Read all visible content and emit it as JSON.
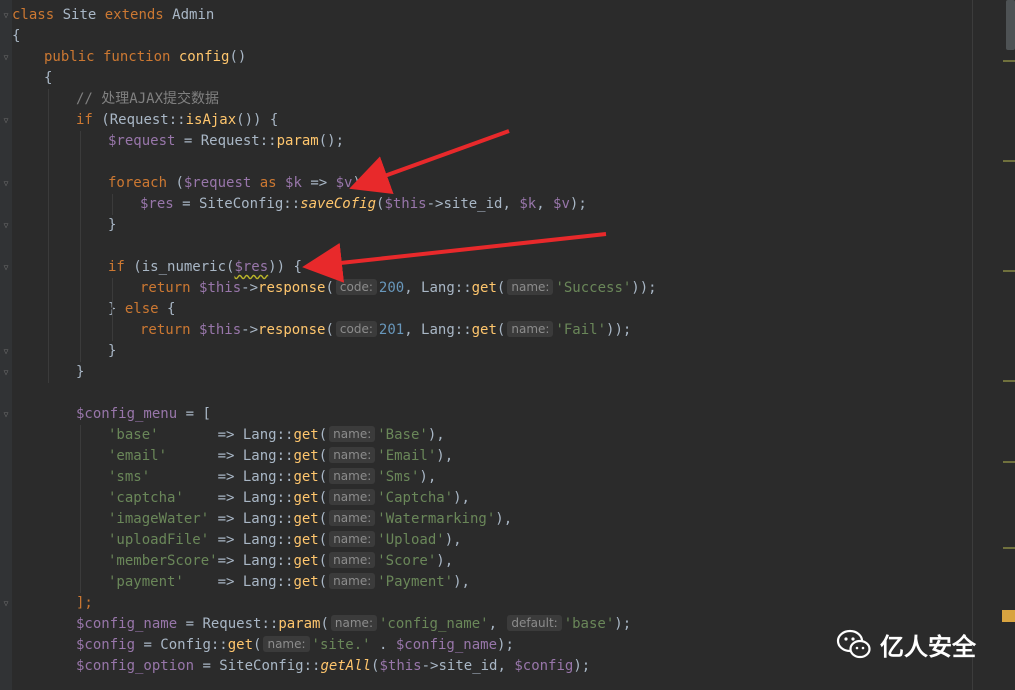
{
  "editor": {
    "language": "PHP",
    "lines": [
      {
        "i": 0,
        "tokens": [
          [
            "kw",
            "class"
          ],
          [
            "p",
            " Site "
          ],
          [
            "kw",
            "extends"
          ],
          [
            "p",
            " Admin"
          ]
        ]
      },
      {
        "i": 0,
        "tokens": [
          [
            "p",
            "{"
          ]
        ]
      },
      {
        "i": 1,
        "tokens": [
          [
            "kw",
            "public function "
          ],
          [
            "fn",
            "config"
          ],
          [
            "p",
            "()"
          ]
        ]
      },
      {
        "i": 1,
        "tokens": [
          [
            "p",
            "{"
          ]
        ]
      },
      {
        "i": 2,
        "tokens": [
          [
            "cmt",
            "// 处理AJAX提交数据"
          ]
        ]
      },
      {
        "i": 2,
        "tokens": [
          [
            "kw",
            "if "
          ],
          [
            "p",
            "(Request::"
          ],
          [
            "fn",
            "isAjax"
          ],
          [
            "p",
            "()) {"
          ]
        ]
      },
      {
        "i": 3,
        "tokens": [
          [
            "var",
            "$request"
          ],
          [
            "p",
            " = Request::"
          ],
          [
            "fn",
            "param"
          ],
          [
            "p",
            "();"
          ]
        ]
      },
      {
        "i": 3,
        "tokens": []
      },
      {
        "i": 3,
        "tokens": [
          [
            "kw",
            "foreach "
          ],
          [
            "p",
            "("
          ],
          [
            "var",
            "$request"
          ],
          [
            "kw",
            " as "
          ],
          [
            "var",
            "$k"
          ],
          [
            "p",
            " => "
          ],
          [
            "var",
            "$v"
          ],
          [
            "p",
            ") {"
          ]
        ]
      },
      {
        "i": 4,
        "tokens": [
          [
            "var",
            "$res"
          ],
          [
            "p",
            " = SiteConfig::"
          ],
          [
            "fn-i",
            "saveCofig"
          ],
          [
            "p",
            "("
          ],
          [
            "var",
            "$this"
          ],
          [
            "p",
            "->site_id, "
          ],
          [
            "var",
            "$k"
          ],
          [
            "p",
            ", "
          ],
          [
            "var",
            "$v"
          ],
          [
            "p",
            ");"
          ]
        ]
      },
      {
        "i": 3,
        "tokens": [
          [
            "p",
            "}"
          ]
        ]
      },
      {
        "i": 3,
        "tokens": []
      },
      {
        "i": 3,
        "tokens": [
          [
            "kw",
            "if "
          ],
          [
            "p",
            "(is_numeric("
          ],
          [
            "var-squig",
            "$res"
          ],
          [
            "p",
            ")) {"
          ]
        ]
      },
      {
        "i": 4,
        "tokens": [
          [
            "kw",
            "return "
          ],
          [
            "var",
            "$this"
          ],
          [
            "p",
            "->"
          ],
          [
            "fn",
            "response"
          ],
          [
            "p",
            "("
          ],
          [
            "hint",
            "code:"
          ],
          [
            "num",
            "200"
          ],
          [
            "p",
            ", Lang::"
          ],
          [
            "fn",
            "get"
          ],
          [
            "p",
            "("
          ],
          [
            "hint",
            "name:"
          ],
          [
            "str",
            "'Success'"
          ],
          [
            "p",
            "));"
          ]
        ]
      },
      {
        "i": 3,
        "tokens": [
          [
            "p",
            "} "
          ],
          [
            "kw",
            "else "
          ],
          [
            "p",
            "{"
          ]
        ]
      },
      {
        "i": 4,
        "tokens": [
          [
            "kw",
            "return "
          ],
          [
            "var",
            "$this"
          ],
          [
            "p",
            "->"
          ],
          [
            "fn",
            "response"
          ],
          [
            "p",
            "("
          ],
          [
            "hint",
            "code:"
          ],
          [
            "num",
            "201"
          ],
          [
            "p",
            ", Lang::"
          ],
          [
            "fn",
            "get"
          ],
          [
            "p",
            "("
          ],
          [
            "hint",
            "name:"
          ],
          [
            "str",
            "'Fail'"
          ],
          [
            "p",
            "));"
          ]
        ]
      },
      {
        "i": 3,
        "tokens": [
          [
            "p",
            "}"
          ]
        ]
      },
      {
        "i": 2,
        "tokens": [
          [
            "p",
            "}"
          ]
        ]
      },
      {
        "i": 2,
        "tokens": []
      },
      {
        "i": 2,
        "tokens": [
          [
            "var",
            "$config_menu"
          ],
          [
            "p",
            " = ["
          ]
        ]
      },
      {
        "i": 3,
        "tokens": [
          [
            "str",
            "'base'"
          ],
          [
            "p",
            "       => Lang::"
          ],
          [
            "fn",
            "get"
          ],
          [
            "p",
            "("
          ],
          [
            "hint",
            "name:"
          ],
          [
            "str",
            "'Base'"
          ],
          [
            "p",
            "),"
          ]
        ]
      },
      {
        "i": 3,
        "tokens": [
          [
            "str",
            "'email'"
          ],
          [
            "p",
            "      => Lang::"
          ],
          [
            "fn",
            "get"
          ],
          [
            "p",
            "("
          ],
          [
            "hint",
            "name:"
          ],
          [
            "str",
            "'Email'"
          ],
          [
            "p",
            "),"
          ]
        ]
      },
      {
        "i": 3,
        "tokens": [
          [
            "str",
            "'sms'"
          ],
          [
            "p",
            "        => Lang::"
          ],
          [
            "fn",
            "get"
          ],
          [
            "p",
            "("
          ],
          [
            "hint",
            "name:"
          ],
          [
            "str",
            "'Sms'"
          ],
          [
            "p",
            "),"
          ]
        ]
      },
      {
        "i": 3,
        "tokens": [
          [
            "str",
            "'captcha'"
          ],
          [
            "p",
            "    => Lang::"
          ],
          [
            "fn",
            "get"
          ],
          [
            "p",
            "("
          ],
          [
            "hint",
            "name:"
          ],
          [
            "str",
            "'Captcha'"
          ],
          [
            "p",
            "),"
          ]
        ]
      },
      {
        "i": 3,
        "tokens": [
          [
            "str",
            "'imageWater'"
          ],
          [
            "p",
            " => Lang::"
          ],
          [
            "fn",
            "get"
          ],
          [
            "p",
            "("
          ],
          [
            "hint",
            "name:"
          ],
          [
            "str",
            "'Watermarking'"
          ],
          [
            "p",
            "),"
          ]
        ]
      },
      {
        "i": 3,
        "tokens": [
          [
            "str",
            "'uploadFile'"
          ],
          [
            "p",
            " => Lang::"
          ],
          [
            "fn",
            "get"
          ],
          [
            "p",
            "("
          ],
          [
            "hint",
            "name:"
          ],
          [
            "str",
            "'Upload'"
          ],
          [
            "p",
            "),"
          ]
        ]
      },
      {
        "i": 3,
        "tokens": [
          [
            "str",
            "'memberScore'"
          ],
          [
            "p",
            "=> Lang::"
          ],
          [
            "fn",
            "get"
          ],
          [
            "p",
            "("
          ],
          [
            "hint",
            "name:"
          ],
          [
            "str",
            "'Score'"
          ],
          [
            "p",
            "),"
          ]
        ]
      },
      {
        "i": 3,
        "tokens": [
          [
            "str",
            "'payment'"
          ],
          [
            "p",
            "    => Lang::"
          ],
          [
            "fn",
            "get"
          ],
          [
            "p",
            "("
          ],
          [
            "hint",
            "name:"
          ],
          [
            "str",
            "'Payment'"
          ],
          [
            "p",
            "),"
          ]
        ]
      },
      {
        "i": 2,
        "tokens": [
          [
            "kw",
            "];"
          ]
        ]
      },
      {
        "i": 2,
        "tokens": [
          [
            "var",
            "$config_name"
          ],
          [
            "p",
            " = Request::"
          ],
          [
            "fn",
            "param"
          ],
          [
            "p",
            "("
          ],
          [
            "hint",
            "name:"
          ],
          [
            "str",
            "'config_name'"
          ],
          [
            "p",
            ", "
          ],
          [
            "hint",
            "default:"
          ],
          [
            "str",
            "'base'"
          ],
          [
            "p",
            ");"
          ]
        ]
      },
      {
        "i": 2,
        "tokens": [
          [
            "var",
            "$config"
          ],
          [
            "p",
            " = Config::"
          ],
          [
            "fn",
            "get"
          ],
          [
            "p",
            "("
          ],
          [
            "hint",
            "name:"
          ],
          [
            "str",
            "'site.'"
          ],
          [
            "p",
            " . "
          ],
          [
            "var",
            "$config_name"
          ],
          [
            "p",
            ");"
          ]
        ]
      },
      {
        "i": 2,
        "tokens": [
          [
            "var",
            "$config_option"
          ],
          [
            "p",
            " = SiteConfig::"
          ],
          [
            "fn-i",
            "getAll"
          ],
          [
            "p",
            "("
          ],
          [
            "var",
            "$this"
          ],
          [
            "p",
            "->site_id, "
          ],
          [
            "var",
            "$config"
          ],
          [
            "p",
            ");"
          ]
        ]
      }
    ]
  },
  "watermark": {
    "text": "亿人安全",
    "icon": "wechat-icon"
  },
  "colors": {
    "background": "#2b2b2b",
    "keyword": "#cc7832",
    "function": "#ffc66d",
    "variable": "#9876aa",
    "string": "#6a8759",
    "number": "#6897bb",
    "comment": "#808080",
    "arrow": "#e8292b"
  }
}
